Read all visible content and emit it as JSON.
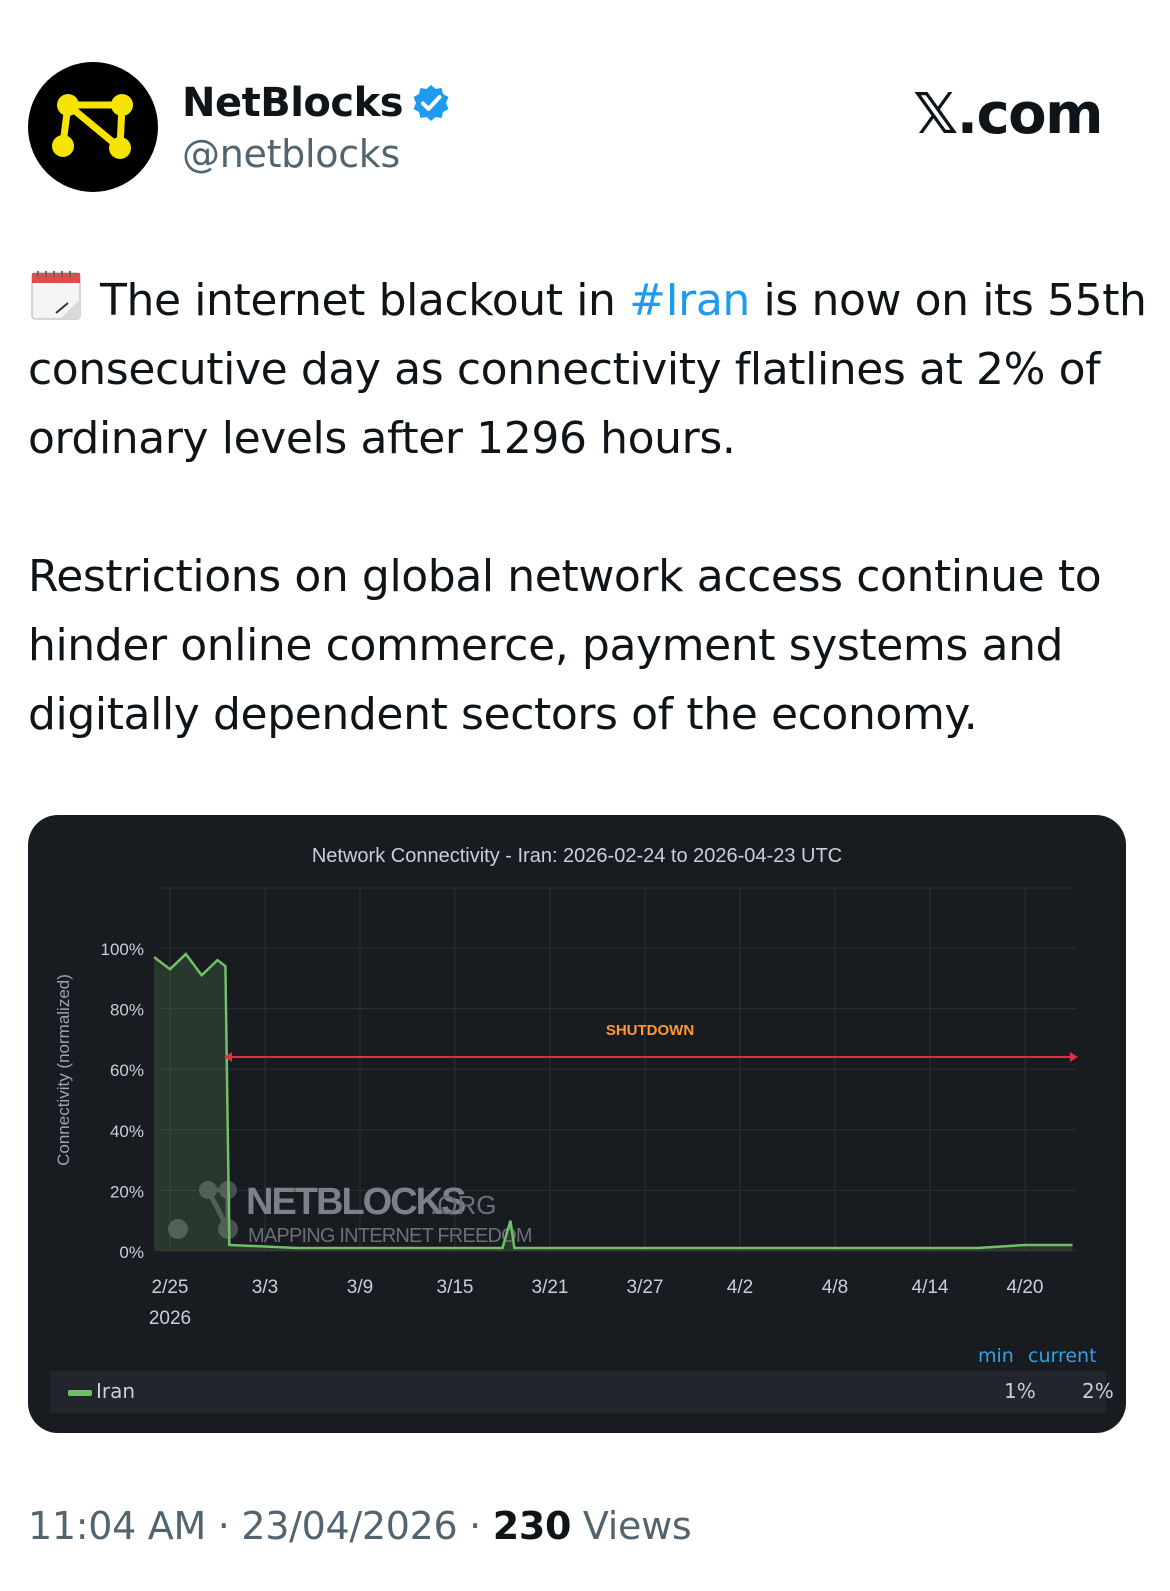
{
  "author": {
    "name": "NetBlocks",
    "handle": "@netblocks",
    "verified": true,
    "avatar_icon": "netblocks-logo"
  },
  "site_logo": "𝕏.com",
  "tweet": {
    "emoji": "calendar-icon",
    "line1_before": "The internet blackout in ",
    "hashtag": "#Iran",
    "line1_after": " is now on its 55th consecutive day as connectivity flatlines at 2% of ordinary levels after 1296 hours.",
    "paragraph2": "Restrictions on global network access continue to hinder online commerce, payment systems and digitally dependent sectors of the economy."
  },
  "chart_data": {
    "type": "line",
    "title": "Network Connectivity - Iran: 2026-02-24 to 2026-04-23 UTC",
    "ylabel": "Connectivity (normalized)",
    "xlabel": "",
    "ylim": [
      0,
      100
    ],
    "yticks": [
      "100%",
      "80%",
      "60%",
      "40%",
      "20%",
      "0%"
    ],
    "xticks": [
      "2/25",
      "3/3",
      "3/9",
      "3/15",
      "3/21",
      "3/27",
      "4/2",
      "4/8",
      "4/14",
      "4/20"
    ],
    "xtick_sub": "2026",
    "grid": true,
    "annotation": "SHUTDOWN",
    "watermark": {
      "brand": "NETBLOCKS",
      "suffix": ".ORG",
      "tagline": "MAPPING INTERNET FREEDOM"
    },
    "series": [
      {
        "name": "Iran",
        "color": "#73bf69",
        "points": [
          [
            "2026-02-24",
            97
          ],
          [
            "2026-02-25",
            93
          ],
          [
            "2026-02-26",
            98
          ],
          [
            "2026-02-27",
            91
          ],
          [
            "2026-02-28",
            96
          ],
          [
            "2026-02-28T12",
            94
          ],
          [
            "2026-02-28T18",
            2
          ],
          [
            "2026-03-05",
            1
          ],
          [
            "2026-03-10",
            1
          ],
          [
            "2026-03-15",
            1
          ],
          [
            "2026-03-18",
            1
          ],
          [
            "2026-03-18T12",
            10
          ],
          [
            "2026-03-18T18",
            1
          ],
          [
            "2026-03-25",
            1
          ],
          [
            "2026-04-02",
            1
          ],
          [
            "2026-04-10",
            1
          ],
          [
            "2026-04-17",
            1
          ],
          [
            "2026-04-20",
            2
          ],
          [
            "2026-04-23",
            2
          ]
        ]
      }
    ],
    "legend": {
      "columns": [
        "min",
        "current"
      ],
      "rows": [
        {
          "name": "Iran",
          "min": "1%",
          "current": "2%"
        }
      ]
    }
  },
  "meta": {
    "time": "11:04 AM",
    "date": "23/04/2026",
    "views_count": "230",
    "views_label": "Views",
    "separator": "·"
  }
}
